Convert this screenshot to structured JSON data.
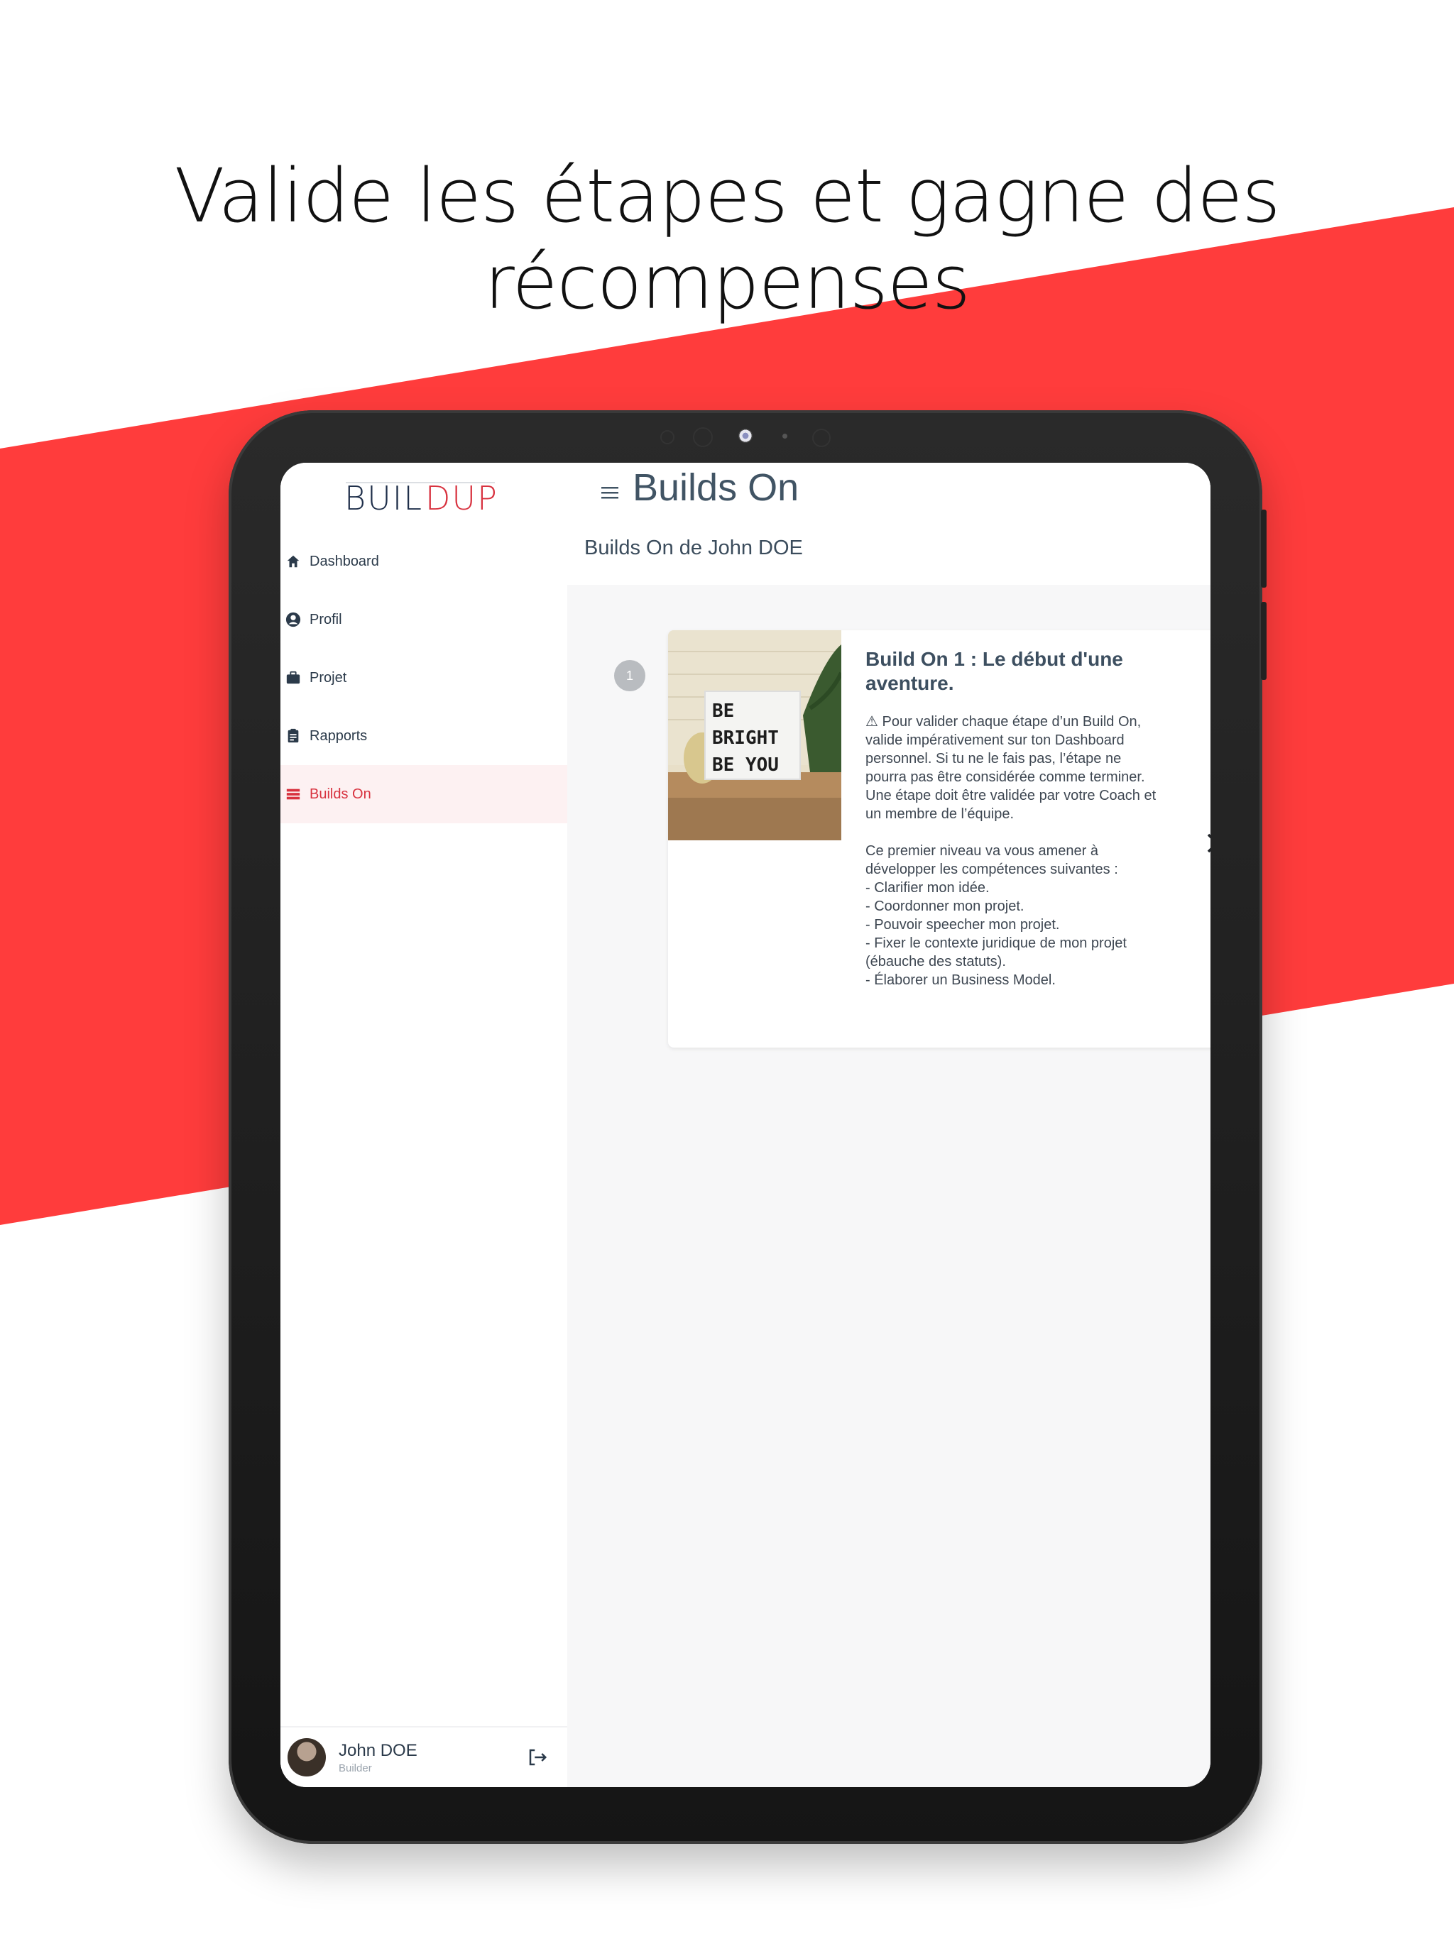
{
  "headline": "Valide les étapes et gagne des récompenses",
  "colors": {
    "accent": "#ff3c3c",
    "active": "#d8323f",
    "text": "#3d4f60"
  },
  "app": {
    "logo_text": "BUILDUP",
    "sidebar": {
      "items": [
        {
          "label": "Dashboard",
          "icon": "home-icon",
          "active": false
        },
        {
          "label": "Profil",
          "icon": "user-circle-icon",
          "active": false
        },
        {
          "label": "Projet",
          "icon": "briefcase-icon",
          "active": false
        },
        {
          "label": "Rapports",
          "icon": "clipboard-icon",
          "active": false
        },
        {
          "label": "Builds On",
          "icon": "stack-icon",
          "active": true
        }
      ],
      "user": {
        "name": "John DOE",
        "role": "Builder"
      }
    },
    "header": {
      "title": "Builds On",
      "subtitle": "Builds On de John DOE"
    },
    "step": {
      "number": "1"
    },
    "card": {
      "image_text": [
        "BE",
        "BRIGHT",
        "BE YOU"
      ],
      "title": "Build On 1 : Le début d'une aventure.",
      "description": "⚠ Pour valider chaque étape d’un Build On, valide impérativement sur ton Dashboard personnel. Si tu ne le fais pas, l’étape ne pourra pas être considérée comme terminer. Une étape doit être validée par votre Coach et un membre de l’équipe.\n\nCe premier niveau va vous amener à développer les compétences suivantes :\n- Clarifier mon idée.\n- Coordonner mon projet.\n- Pouvoir speecher mon projet.\n- Fixer le contexte juridique de mon projet (ébauche des statuts).\n- Élaborer un Business Model."
    }
  }
}
